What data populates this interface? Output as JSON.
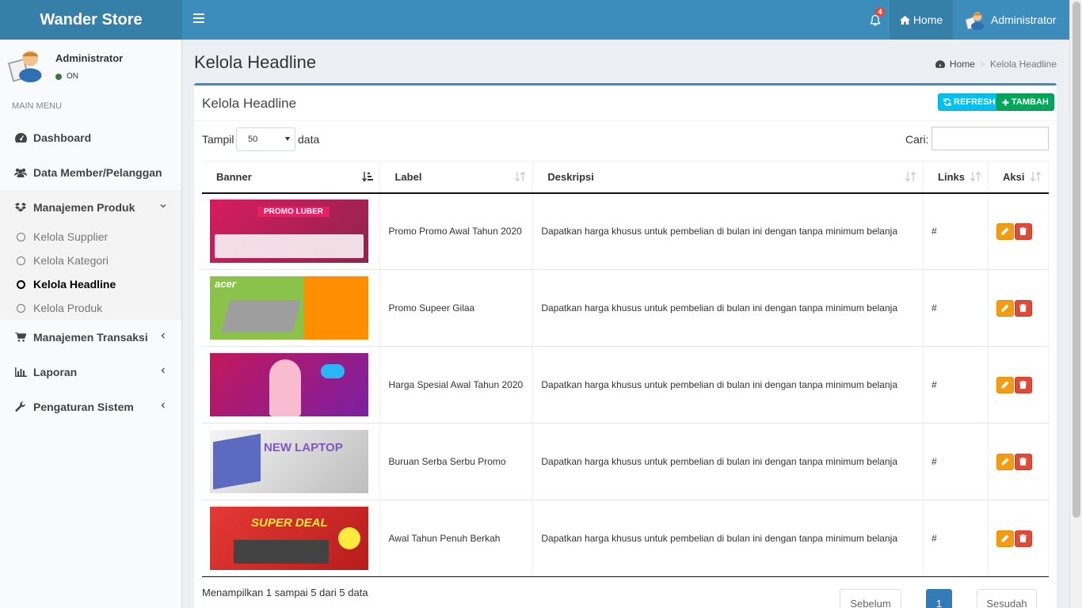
{
  "header": {
    "brand": "Wander Store",
    "notif_count": "4",
    "home_label": "Home",
    "user_name": "Administrator"
  },
  "sidebar": {
    "user_name": "Administrator",
    "status": "ON",
    "menu_header": "MAIN MENU",
    "items": [
      {
        "label": "Dashboard"
      },
      {
        "label": "Data Member/Pelanggan"
      },
      {
        "label": "Manajemen Produk"
      },
      {
        "label": "Manajemen Transaksi"
      },
      {
        "label": "Laporan"
      },
      {
        "label": "Pengaturan Sistem"
      }
    ],
    "subitems": [
      {
        "label": "Kelola Supplier"
      },
      {
        "label": "Kelola Kategori"
      },
      {
        "label": "Kelola Headline"
      },
      {
        "label": "Kelola Produk"
      }
    ]
  },
  "page": {
    "title": "Kelola Headline",
    "breadcrumb_home": "Home",
    "breadcrumb_current": "Kelola Headline"
  },
  "box": {
    "title": "Kelola Headline",
    "refresh_label": "REFRESH",
    "add_label": "TAMBAH",
    "show_label": "Tampil",
    "show_value": "50",
    "show_after": "data",
    "search_label": "Cari:",
    "search_value": ""
  },
  "table": {
    "columns": [
      "Banner",
      "Label",
      "Deskripsi",
      "Links",
      "Aksi"
    ],
    "rows": [
      {
        "label": "Promo Promo Awal Tahun 2020",
        "desc": "Dapatkan harga khusus untuk pembelian di bulan ini dengan tanpa minimum belanja",
        "link": "#",
        "banner_bg": "#c2185b",
        "banner_text": "PROMO LUBER"
      },
      {
        "label": "Promo Supeer Gilaa",
        "desc": "Dapatkan harga khusus untuk pembelian di bulan ini dengan tanpa minimum belanja",
        "link": "#",
        "banner_bg": "#7cb342",
        "banner_text": "acer"
      },
      {
        "label": "Harga Spesial Awal Tahun 2020",
        "desc": "Dapatkan harga khusus untuk pembelian di bulan ini dengan tanpa minimum belanja",
        "link": "#",
        "banner_bg": "#ad1457",
        "banner_text": ""
      },
      {
        "label": "Buruan Serba Serbu Promo",
        "desc": "Dapatkan harga khusus untuk pembelian di bulan ini dengan tanpa minimum belanja",
        "link": "#",
        "banner_bg": "#e0e0e0",
        "banner_text": "NEW LAPTOP"
      },
      {
        "label": "Awal Tahun Penuh Berkah",
        "desc": "Dapatkan harga khusus untuk pembelian di bulan ini dengan tanpa minimum belanja",
        "link": "#",
        "banner_bg": "#d32f2f",
        "banner_text": "SUPER DEAL"
      }
    ]
  },
  "footer": {
    "info": "Menampilkan 1 sampai 5 dari 5 data",
    "prev": "Sebelum",
    "page": "1",
    "next": "Sesudah"
  }
}
